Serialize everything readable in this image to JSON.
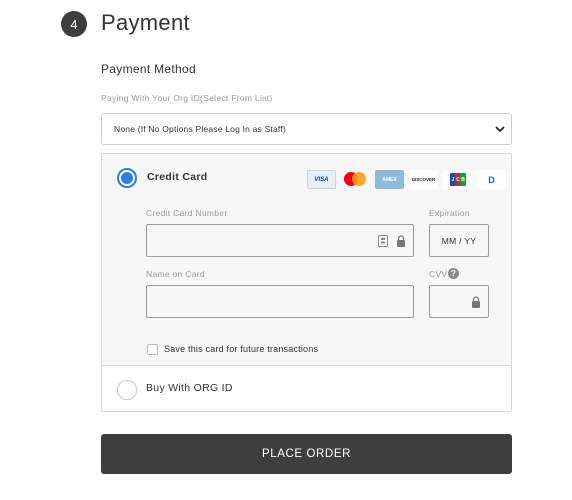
{
  "section": {
    "step": "4",
    "title": "Payment"
  },
  "payment_method": {
    "label": "Payment Method",
    "org_label": "Paying With Your Org ID(Select From List)",
    "org_select_value": "None (If No Options Please Log In as Staff)"
  },
  "credit_card": {
    "label": "Credit Card",
    "selected": true,
    "card_brands": [
      "VISA",
      "Mastercard",
      "AMEX",
      "DISCOVER",
      "JCB",
      "Diners Club"
    ],
    "number_label": "Credit Card Number",
    "number_value": "",
    "expiration_label": "Expiration",
    "expiration_placeholder": "MM / YY",
    "name_label": "Name on Card",
    "name_value": "",
    "cvv_label": "CVV",
    "cvv_value": "",
    "save_card_label": "Save this card for future transactions",
    "save_card_checked": false
  },
  "org_option": {
    "label": "Buy With ORG ID",
    "selected": false
  },
  "place_order": {
    "label": "PLACE ORDER"
  },
  "colors": {
    "accent": "#2f7de1",
    "button": "#3e3e3e",
    "badge": "#3d3d3d"
  }
}
